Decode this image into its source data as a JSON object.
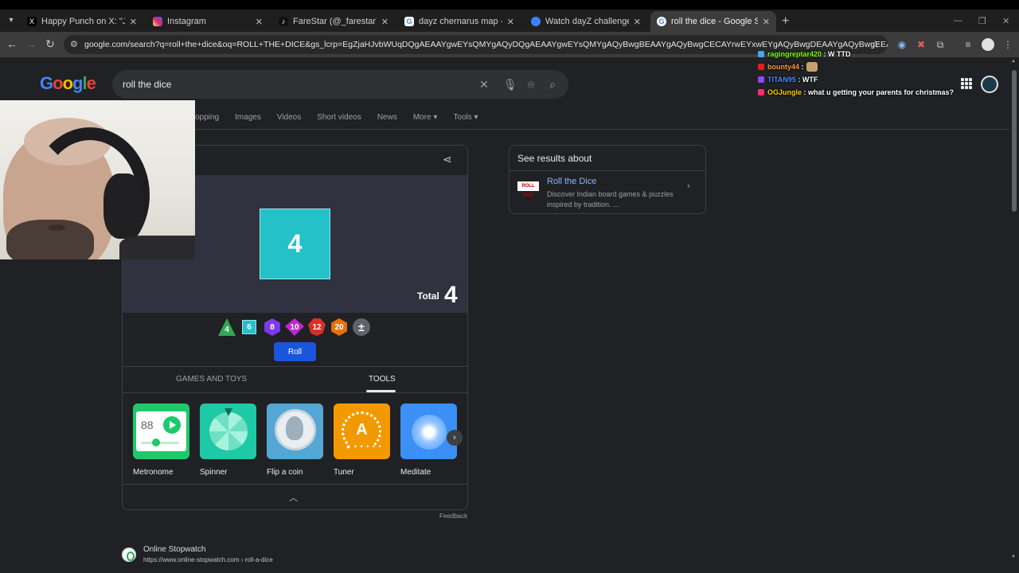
{
  "browser": {
    "tabs": [
      {
        "label": "Happy Punch on X: \"Jake Paul w",
        "favicon": "x-logo-icon",
        "color": "#000000"
      },
      {
        "label": "Instagram",
        "favicon": "instagram-icon",
        "color": "#d6249f"
      },
      {
        "label": "FareStar (@_farestar) | TikTok",
        "favicon": "tiktok-icon",
        "color": "#111111"
      },
      {
        "label": "dayz chernarus map - Google S",
        "favicon": "google-icon",
        "color": "#ffffff"
      },
      {
        "label": "Watch dayZ challenge | Stream",
        "favicon": "stream-icon",
        "color": "#3b82f6"
      },
      {
        "label": "roll the dice - Google Search",
        "favicon": "google-icon",
        "color": "#ffffff"
      }
    ],
    "url": "google.com/search?q=roll+the+dice&oq=ROLL+THE+DICE&gs_lcrp=EgZjaHJvbWUqDQgAEAAYgwEYsQMYgAQyDQgAEAAYgwEYsQMYgAQyBwgBEAAYgAQyBwgCECAYrwEYxwEYgAQyBwgDEAAYgAQyBwgEEAAYgAQyBggFEAAYAzIHCAYQ..."
  },
  "search": {
    "logo": "Google",
    "query": "roll the dice",
    "nav_tabs": [
      "opping",
      "Images",
      "Videos",
      "Short videos",
      "News",
      "More ▾",
      "Tools ▾"
    ]
  },
  "dice": {
    "face_value": "4",
    "total_label": "Total",
    "total_value": "4",
    "dice_options": [
      "4",
      "6",
      "8",
      "10",
      "12",
      "20",
      "±"
    ],
    "roll_label": "Roll",
    "subtabs": [
      "GAMES AND TOYS",
      "TOOLS"
    ],
    "active_subtab": "TOOLS",
    "tools": [
      {
        "name": "Metronome",
        "icon": "metronome-icon",
        "display": "88"
      },
      {
        "name": "Spinner",
        "icon": "spinner-wheel-icon"
      },
      {
        "name": "Flip a coin",
        "icon": "coin-icon"
      },
      {
        "name": "Tuner",
        "icon": "tuner-icon",
        "display": "A"
      },
      {
        "name": "Meditate",
        "icon": "meditate-icon"
      }
    ],
    "feedback": "Feedback"
  },
  "result": {
    "site": "Online Stopwatch",
    "url": "https://www.online-stopwatch.com › roll-a-dice"
  },
  "panel": {
    "title": "See results about",
    "thumb_text": "ROLL DICE",
    "name": "Roll the Dice",
    "description": "Discover Indian board games & puzzles inspired by tradition. ..."
  },
  "chat": [
    {
      "user": "ragingreptar420",
      "message": "W TTD",
      "color": "#7cfc00",
      "badge": "#3fa9f5"
    },
    {
      "user": "bounty44",
      "message": "",
      "color": "#ff9d2e",
      "badge": "#e01e1e",
      "emote": true
    },
    {
      "user": "TITAN95",
      "message": "WTF",
      "color": "#4d8bff",
      "badge": "#9146ff"
    },
    {
      "user": "OGJungle",
      "message": "what u getting your parents for christmas?",
      "color": "#ffcc00",
      "badge": "#ff2d6f"
    }
  ]
}
